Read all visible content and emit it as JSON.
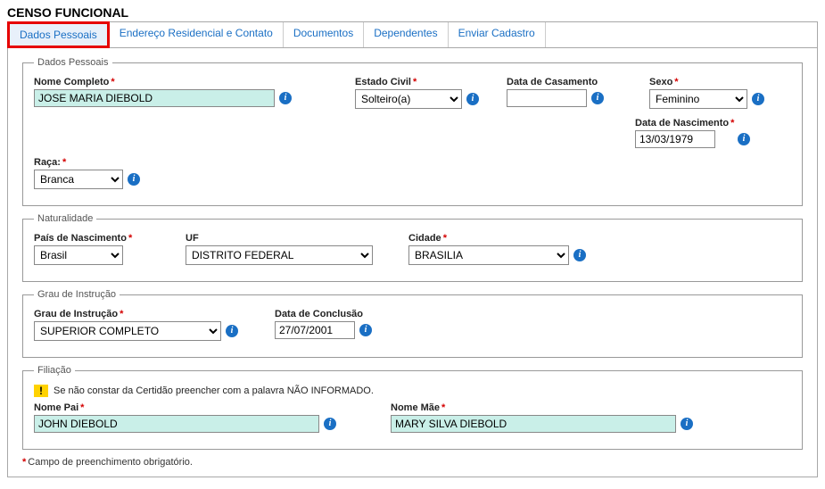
{
  "title": "CENSO FUNCIONAL",
  "tabs": [
    "Dados Pessoais",
    "Endereço Residencial e Contato",
    "Documentos",
    "Dependentes",
    "Enviar Cadastro"
  ],
  "dadosPessoais": {
    "legend": "Dados Pessoais",
    "nomeCompleto": {
      "label": "Nome Completo",
      "value": "JOSE MARIA DIEBOLD"
    },
    "estadoCivil": {
      "label": "Estado Civil",
      "value": "Solteiro(a)"
    },
    "dataCasamento": {
      "label": "Data de Casamento",
      "value": ""
    },
    "sexo": {
      "label": "Sexo",
      "value": "Feminino"
    },
    "dataNascimento": {
      "label": "Data de Nascimento",
      "value": "13/03/1979"
    },
    "raca": {
      "label": "Raça:",
      "value": "Branca"
    }
  },
  "naturalidade": {
    "legend": "Naturalidade",
    "pais": {
      "label": "País de Nascimento",
      "value": "Brasil"
    },
    "uf": {
      "label": "UF",
      "value": "DISTRITO FEDERAL"
    },
    "cidade": {
      "label": "Cidade",
      "value": "BRASILIA"
    }
  },
  "grauInstrucao": {
    "legend": "Grau de Instrução",
    "grau": {
      "label": "Grau de Instrução",
      "value": "SUPERIOR COMPLETO"
    },
    "dataConclusao": {
      "label": "Data de Conclusão",
      "value": "27/07/2001"
    }
  },
  "filiacao": {
    "legend": "Filiação",
    "note": "Se não constar da Certidão preencher com a palavra NÃO INFORMADO.",
    "pai": {
      "label": "Nome Pai",
      "value": "JOHN DIEBOLD"
    },
    "mae": {
      "label": "Nome Mãe",
      "value": "MARY SILVA DIEBOLD"
    }
  },
  "footnote": "Campo de preenchimento obrigatório."
}
